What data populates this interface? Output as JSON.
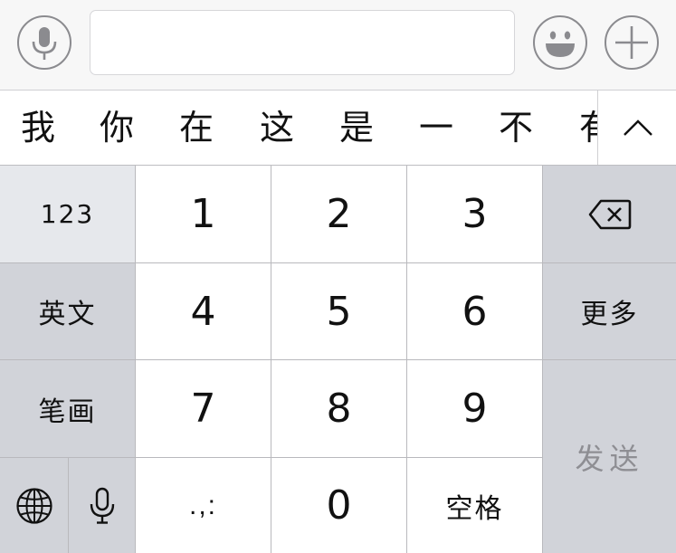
{
  "candidates": [
    "我",
    "你",
    "在",
    "这",
    "是",
    "一",
    "不",
    "有"
  ],
  "keys": {
    "row1": {
      "left": "123",
      "k1": "1",
      "k2": "2",
      "k3": "3"
    },
    "row2": {
      "left": "英文",
      "k1": "4",
      "k2": "5",
      "k3": "6",
      "right": "更多"
    },
    "row3": {
      "left": "笔画",
      "k1": "7",
      "k2": "8",
      "k3": "9"
    },
    "row4": {
      "punct": ".,:",
      "k2": "0",
      "space": "空格"
    },
    "send": "发送"
  },
  "icons": {
    "voice": "microphone-icon",
    "emoji": "smiley-icon",
    "plus": "plus-icon",
    "expand": "chevron-up-icon",
    "delete": "backspace-icon",
    "globe": "globe-icon",
    "dictation": "microphone-icon"
  },
  "colors": {
    "keyboard_gray": "#d1d3d9",
    "key_white": "#ffffff",
    "icon_gray": "#8b8b8f",
    "send_disabled_text": "#8e8e93"
  }
}
